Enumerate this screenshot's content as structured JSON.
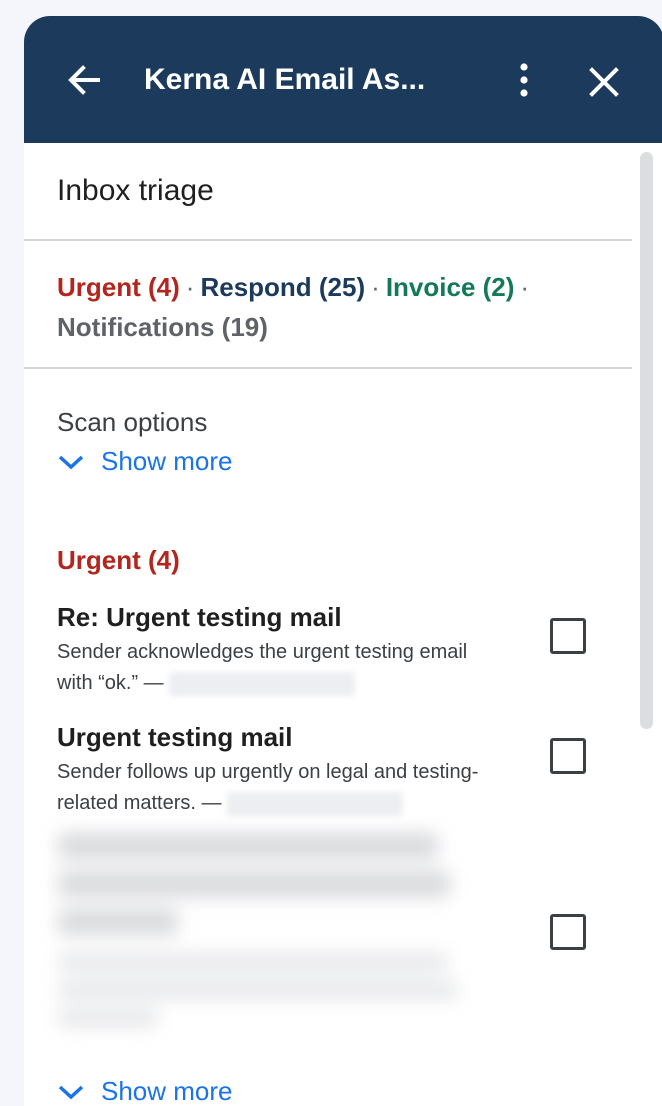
{
  "header": {
    "title": "Kerna AI Email As...",
    "background_color": "#1b3a5c",
    "icons": {
      "back": "back-arrow-icon",
      "menu": "more-vertical-icon",
      "close": "close-icon"
    }
  },
  "section": {
    "title": "Inbox triage"
  },
  "summary": {
    "categories": [
      {
        "label": "Urgent (4)",
        "color": "#b3261e"
      },
      {
        "label": "Respond (25)",
        "color": "#1b3a5c"
      },
      {
        "label": "Invoice (2)",
        "color": "#137a55"
      },
      {
        "label": "Notifications (19)",
        "color": "#5f6368"
      }
    ],
    "separator": "·"
  },
  "scan_options": {
    "label": "Scan options",
    "toggle_label": "Show more",
    "toggle_icon": "chevron-down-icon"
  },
  "urgent_group": {
    "title": "Urgent (4)",
    "emails": [
      {
        "subject": "Re: Urgent testing mail",
        "summary": "Sender acknowledges the urgent testing email with “ok.” —",
        "checked": false
      },
      {
        "subject": "Urgent testing mail",
        "summary": "Sender follows up urgently on legal and testing-related matters. —",
        "checked": false
      },
      {
        "subject": "",
        "summary": "",
        "checked": false
      }
    ],
    "show_more_label": "Show more"
  },
  "colors": {
    "link": "#1a73e8",
    "urgent": "#b3261e"
  }
}
